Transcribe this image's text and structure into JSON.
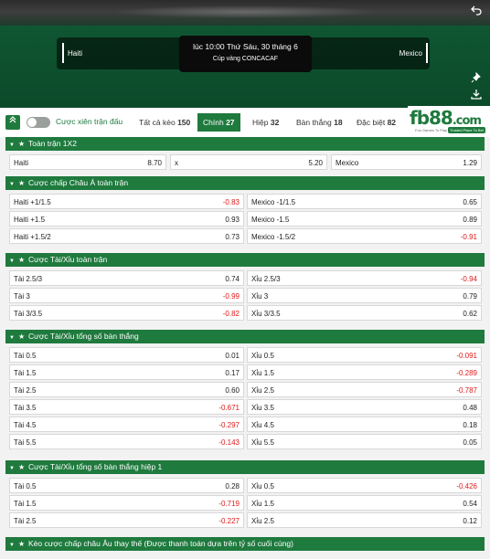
{
  "match": {
    "home": "Haiti",
    "away": "Mexico",
    "time": "lúc 10:00 Thứ Sáu, 30 tháng 6",
    "league": "Cúp vàng CONCACAF"
  },
  "tabs": {
    "parlay_label": "Cược xiên trận đấu",
    "items": [
      {
        "label": "Tất cả kèo",
        "count": "150"
      },
      {
        "label": "Chính",
        "count": "27"
      },
      {
        "label": "Hiệp",
        "count": "32"
      },
      {
        "label": "Bàn thắng",
        "count": "18"
      },
      {
        "label": "Đặc biệt",
        "count": "82"
      }
    ],
    "active": "Chính"
  },
  "logo": {
    "brand": "fb88",
    "suffix": ".com",
    "tag1": "Fun Games To Play",
    "tag2": "Trusted Place To Bet"
  },
  "sections": {
    "s1": {
      "title": "Toàn trận 1X2",
      "cells": [
        {
          "name": "Haiti",
          "odd": "8.70"
        },
        {
          "name": "x",
          "odd": "5.20"
        },
        {
          "name": "Mexico",
          "odd": "1.29"
        }
      ]
    },
    "s2": {
      "title": "Cược chấp Châu Á toàn trận",
      "rows": [
        [
          {
            "name": "Haiti +1/1.5",
            "odd": "-0.83"
          },
          {
            "name": "Mexico -1/1.5",
            "odd": "0.65"
          }
        ],
        [
          {
            "name": "Haiti +1.5",
            "odd": "0.93"
          },
          {
            "name": "Mexico -1.5",
            "odd": "0.89"
          }
        ],
        [
          {
            "name": "Haiti +1.5/2",
            "odd": "0.73"
          },
          {
            "name": "Mexico -1.5/2",
            "odd": "-0.91"
          }
        ]
      ]
    },
    "s3": {
      "title": "Cược Tài/Xỉu toàn trận",
      "rows": [
        [
          {
            "name": "Tài 2.5/3",
            "odd": "0.74"
          },
          {
            "name": "Xỉu 2.5/3",
            "odd": "-0.94"
          }
        ],
        [
          {
            "name": "Tài 3",
            "odd": "-0.99"
          },
          {
            "name": "Xỉu 3",
            "odd": "0.79"
          }
        ],
        [
          {
            "name": "Tài 3/3.5",
            "odd": "-0.82"
          },
          {
            "name": "Xỉu 3/3.5",
            "odd": "0.62"
          }
        ]
      ]
    },
    "s4": {
      "title": "Cược Tài/Xỉu tổng số bàn thắng",
      "rows": [
        [
          {
            "name": "Tài 0.5",
            "odd": "0.01"
          },
          {
            "name": "Xỉu 0.5",
            "odd": "-0.091"
          }
        ],
        [
          {
            "name": "Tài 1.5",
            "odd": "0.17"
          },
          {
            "name": "Xỉu 1.5",
            "odd": "-0.289"
          }
        ],
        [
          {
            "name": "Tài 2.5",
            "odd": "0.60"
          },
          {
            "name": "Xỉu 2.5",
            "odd": "-0.787"
          }
        ],
        [
          {
            "name": "Tài 3.5",
            "odd": "-0.671"
          },
          {
            "name": "Xỉu 3.5",
            "odd": "0.48"
          }
        ],
        [
          {
            "name": "Tài 4.5",
            "odd": "-0.297"
          },
          {
            "name": "Xỉu 4.5",
            "odd": "0.18"
          }
        ],
        [
          {
            "name": "Tài 5.5",
            "odd": "-0.143"
          },
          {
            "name": "Xỉu 5.5",
            "odd": "0.05"
          }
        ]
      ]
    },
    "s5": {
      "title": "Cược Tài/Xỉu tổng số bàn thắng hiệp 1",
      "rows": [
        [
          {
            "name": "Tài 0.5",
            "odd": "0.28"
          },
          {
            "name": "Xỉu 0.5",
            "odd": "-0.426"
          }
        ],
        [
          {
            "name": "Tài 1.5",
            "odd": "-0.719"
          },
          {
            "name": "Xỉu 1.5",
            "odd": "0.54"
          }
        ],
        [
          {
            "name": "Tài 2.5",
            "odd": "-0.227"
          },
          {
            "name": "Xỉu 2.5",
            "odd": "0.12"
          }
        ]
      ]
    },
    "s6": {
      "title": "Kèo cược chấp châu Âu thay thế (Được thanh toán dựa trên tỷ số cuối cùng)"
    }
  },
  "icons": {
    "back": "back-icon",
    "pin": "pin-icon",
    "download": "download-icon",
    "collapse": "collapse-icon",
    "section_arrow": "chevron-down-icon",
    "star": "star-icon"
  },
  "colors": {
    "brand_green": "#1f7a3e",
    "negative_odd": "#e01818"
  }
}
